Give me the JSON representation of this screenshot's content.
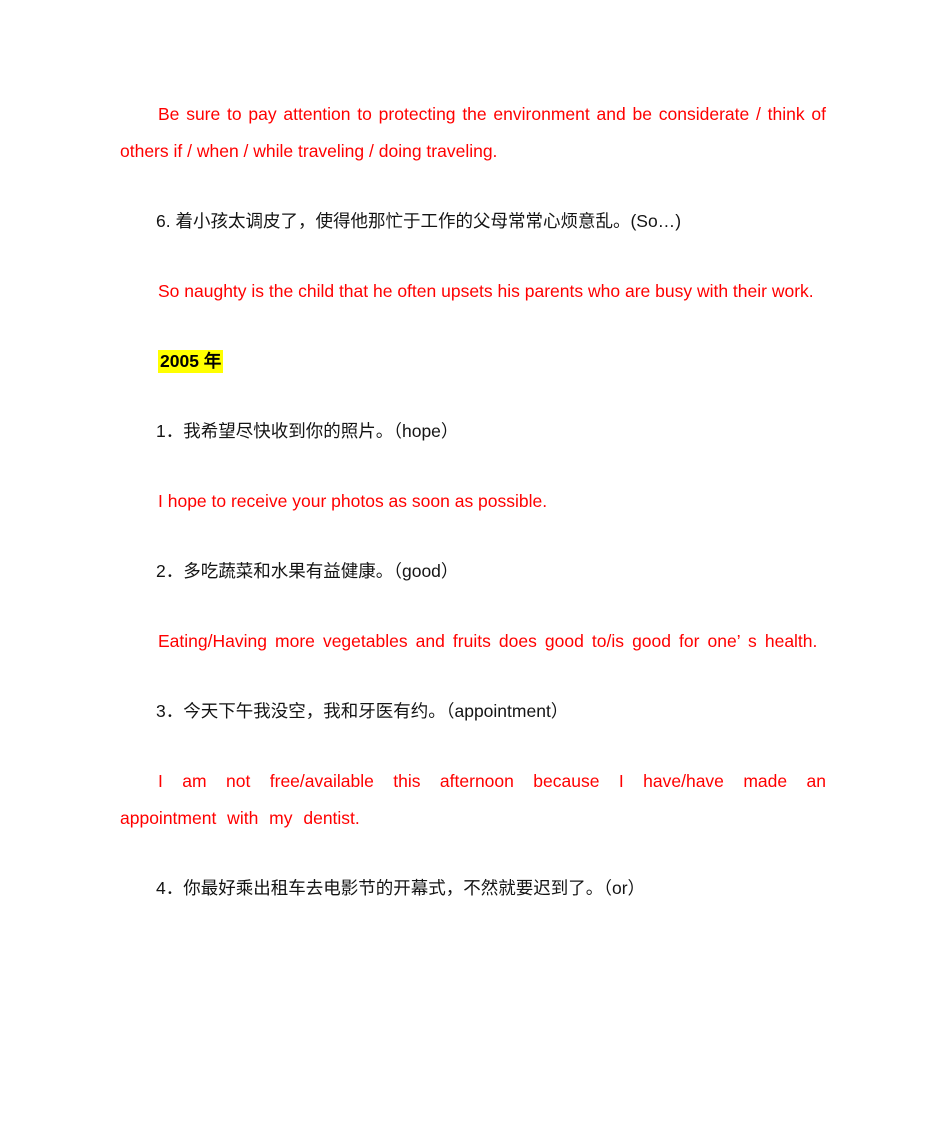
{
  "document": {
    "page_background": "#ffffff",
    "answer_color": "#ff0000",
    "prompt_color": "#141414",
    "highlight_color": "#ffff00",
    "blocks": [
      {
        "id": "answer-5",
        "kind": "answer",
        "text": "Be sure to pay attention to protecting the environment and be considerate / think of others if / when / while traveling / doing traveling."
      },
      {
        "id": "prompt-6",
        "kind": "prompt",
        "text": "6. 着小孩太调皮了，使得他那忙于工作的父母常常心烦意乱。(So…)"
      },
      {
        "id": "answer-6",
        "kind": "answer",
        "text": "So naughty is the child that he often upsets his parents who are busy with their work."
      },
      {
        "id": "year-heading-2005",
        "kind": "heading-highlight",
        "text": "2005 年"
      },
      {
        "id": "prompt-1",
        "kind": "prompt",
        "text": "1．我希望尽快收到你的照片。（hope）"
      },
      {
        "id": "answer-1",
        "kind": "answer",
        "text": "I hope to receive your photos as soon as possible."
      },
      {
        "id": "prompt-2",
        "kind": "prompt",
        "text": "2．多吃蔬菜和水果有益健康。（good）"
      },
      {
        "id": "answer-2",
        "kind": "answer",
        "text": "Eating/Having more vegetables and fruits does good to/is good for one’ s health."
      },
      {
        "id": "prompt-3",
        "kind": "prompt",
        "text": "3．今天下午我没空，我和牙医有约。（appointment）"
      },
      {
        "id": "answer-3",
        "kind": "answer",
        "text": "I am not free/available this afternoon because I have/have made an appointment with my dentist."
      },
      {
        "id": "prompt-4",
        "kind": "prompt",
        "text": "4．你最好乘出租车去电影节的开幕式，不然就要迟到了。（or）"
      }
    ]
  }
}
